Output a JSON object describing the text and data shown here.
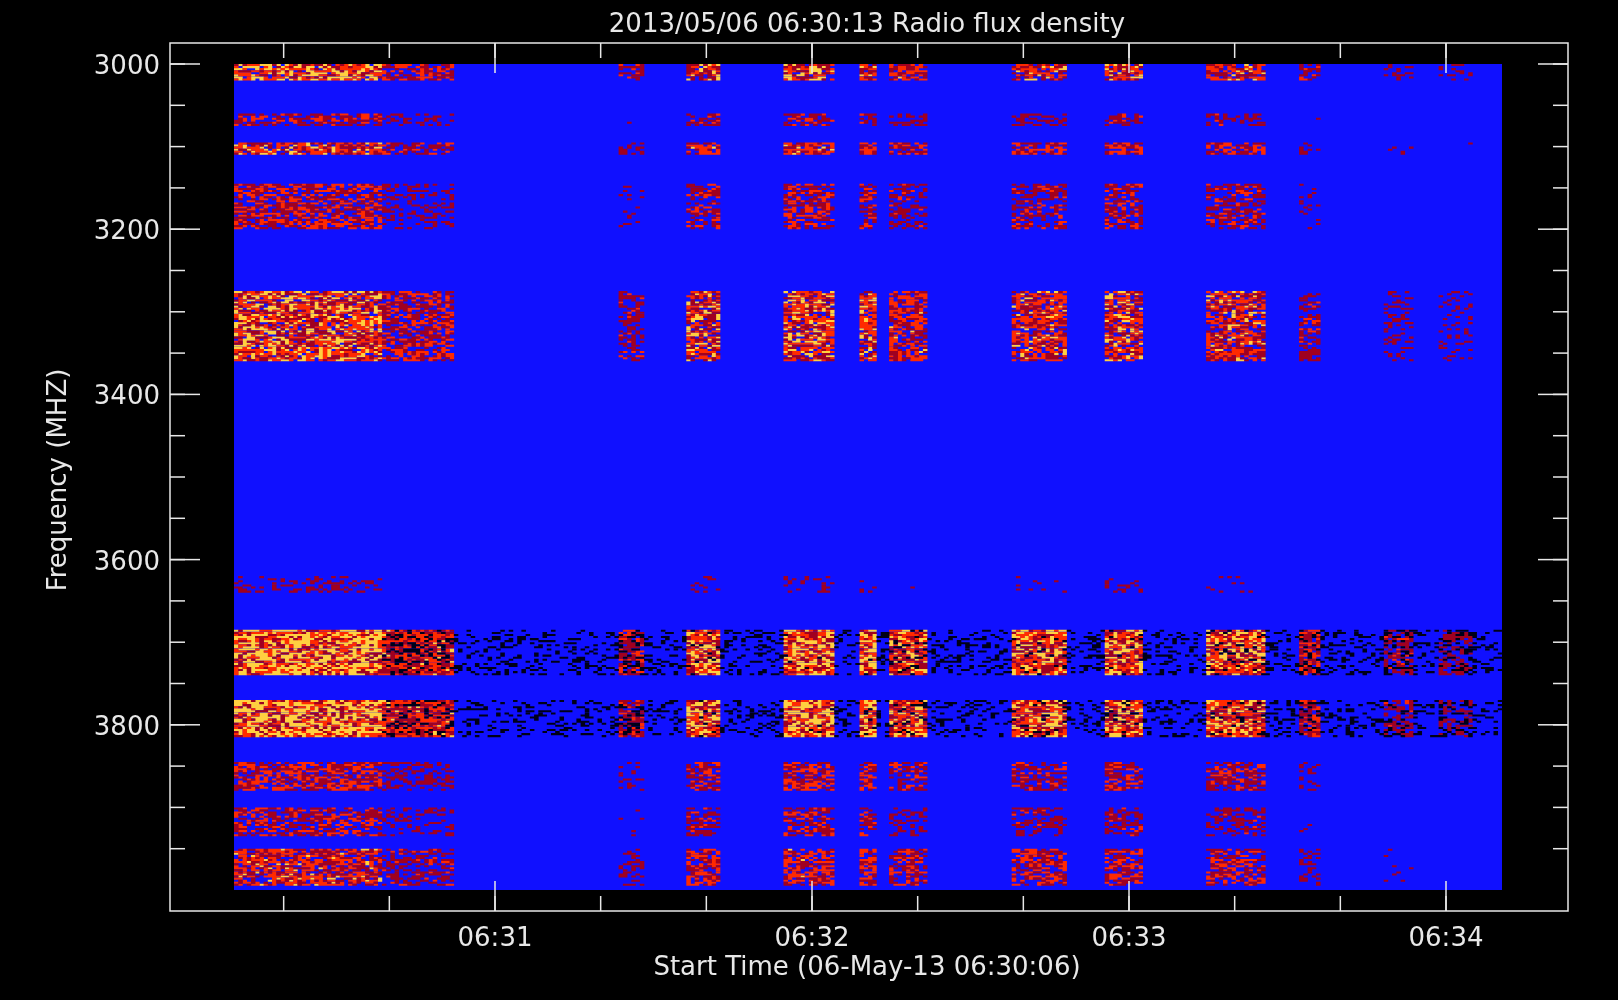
{
  "title": "2013/05/06 06:30:13 Radio flux density",
  "y_axis": {
    "label": "Frequency (MHZ)",
    "ticks": [
      "3000",
      "3200",
      "3400",
      "3600",
      "3800"
    ]
  },
  "x_axis": {
    "label": "Start Time (06-May-13 06:30:06)",
    "ticks": [
      "06:31",
      "06:32",
      "06:33",
      "06:34"
    ]
  }
}
